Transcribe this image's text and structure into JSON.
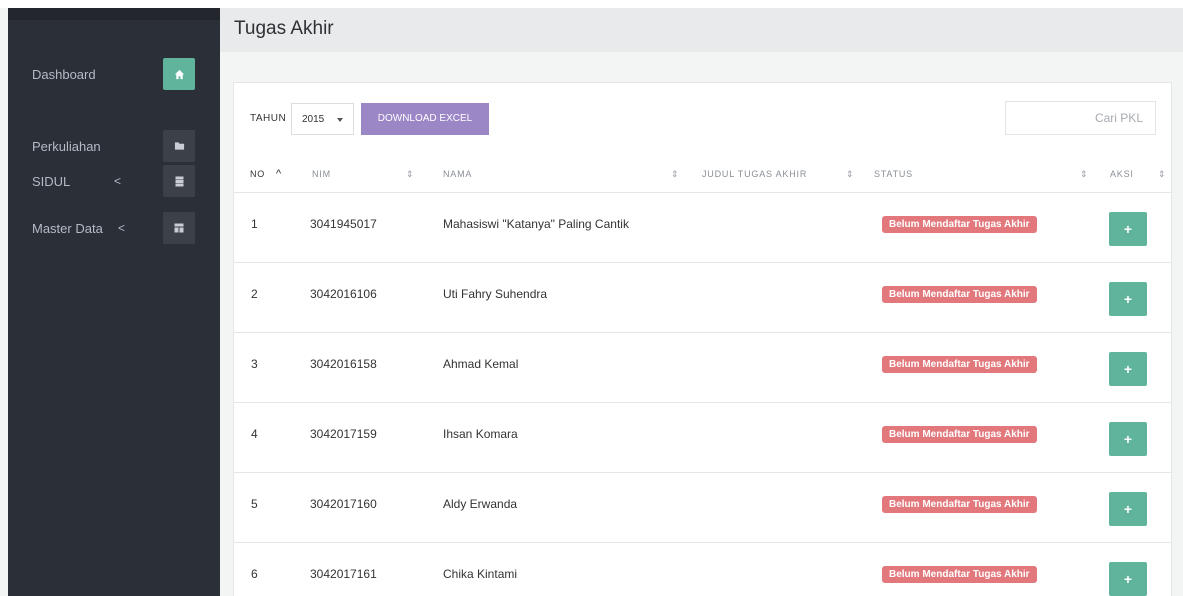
{
  "page": {
    "title": "Tugas Akhir"
  },
  "sidebar": {
    "items": [
      {
        "label": "Dashboard",
        "icon": "home-icon",
        "active": true
      },
      {
        "label": "Perkuliahan",
        "icon": "folder-icon",
        "active": false
      },
      {
        "label": "SIDUL",
        "chevron": "<",
        "icon": "server-icon",
        "active": false
      },
      {
        "label": "Master Data",
        "chevron": "<",
        "icon": "layout-icon",
        "active": false
      }
    ]
  },
  "toolbar": {
    "tahun_label": "TAHUN",
    "year_value": "2015",
    "download_label": "DOWNLOAD EXCEL",
    "search_placeholder": "Cari PKL"
  },
  "table": {
    "columns": [
      "NO",
      "NIM",
      "NAMA",
      "JUDUL TUGAS AKHIR",
      "STATUS",
      "AKSI"
    ],
    "sort_asc_glyph": "^",
    "sort_both_glyph": "⇕",
    "rows": [
      {
        "no": "1",
        "nim": "3041945017",
        "nama": "Mahasiswi \"Katanya\" Paling Cantik",
        "judul": "",
        "status": "Belum Mendaftar Tugas Akhir",
        "action": "+"
      },
      {
        "no": "2",
        "nim": "3042016106",
        "nama": "Uti Fahry Suhendra",
        "judul": "",
        "status": "Belum Mendaftar Tugas Akhir",
        "action": "+"
      },
      {
        "no": "3",
        "nim": "3042016158",
        "nama": "Ahmad Kemal",
        "judul": "",
        "status": "Belum Mendaftar Tugas Akhir",
        "action": "+"
      },
      {
        "no": "4",
        "nim": "3042017159",
        "nama": "Ihsan Komara",
        "judul": "",
        "status": "Belum Mendaftar Tugas Akhir",
        "action": "+"
      },
      {
        "no": "5",
        "nim": "3042017160",
        "nama": "Aldy Erwanda",
        "judul": "",
        "status": "Belum Mendaftar Tugas Akhir",
        "action": "+"
      },
      {
        "no": "6",
        "nim": "3042017161",
        "nama": "Chika Kintami",
        "judul": "",
        "status": "Belum Mendaftar Tugas Akhir",
        "action": "+"
      }
    ]
  },
  "colors": {
    "sidebar_bg": "#2b2f38",
    "accent_green": "#5fb49b",
    "excel_purple": "#9b86c6",
    "status_red": "#e2787c"
  }
}
